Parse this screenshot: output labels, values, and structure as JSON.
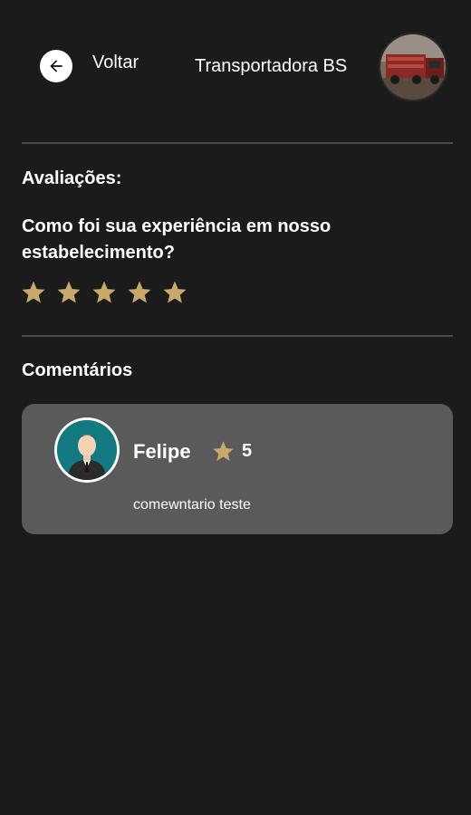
{
  "header": {
    "back_label": "Voltar",
    "company_name": "Transportadora BS"
  },
  "ratings": {
    "title": "Avaliações:",
    "question": "Como foi sua experiência em nosso estabelecimento?",
    "star_count": 5,
    "star_color": "#c8a96a"
  },
  "comments": {
    "title": "Comentários",
    "items": [
      {
        "user_name": "Felipe",
        "rating": "5",
        "text": "comewntario teste"
      }
    ]
  },
  "colors": {
    "background": "#1b1b1b",
    "card": "#5a5a5a",
    "divider": "#4a4a4a",
    "accent_star": "#c8a96a"
  }
}
